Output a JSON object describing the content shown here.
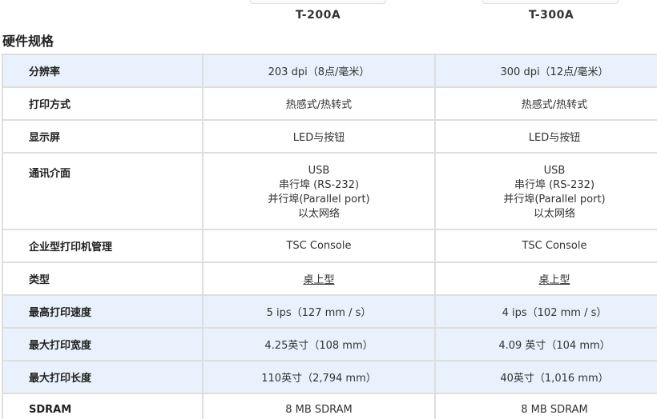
{
  "models": [
    "T-200A",
    "T-300A"
  ],
  "section_title": "硬件规格",
  "rows": [
    {
      "label": "分辨率",
      "v1": [
        "203 dpi（8点/毫米）"
      ],
      "v2": [
        "300 dpi（12点/毫米）"
      ],
      "style": "blue"
    },
    {
      "label": "打印方式",
      "v1": [
        "热感式/热转式"
      ],
      "v2": [
        "热感式/热转式"
      ],
      "style": "white"
    },
    {
      "label": "显示屏",
      "v1": [
        "LED与按钮"
      ],
      "v2": [
        "LED与按钮"
      ],
      "style": "white"
    },
    {
      "label": "通讯介面",
      "v1": [
        "USB",
        "串行埠 (RS-232)",
        "并行埠(Parallel port)",
        "以太网络"
      ],
      "v2": [
        "USB",
        "串行埠 (RS-232)",
        "并行埠(Parallel port)",
        "以太网络"
      ],
      "style": "white"
    },
    {
      "label": "企业型打印机管理",
      "v1": [
        "TSC Console"
      ],
      "v2": [
        "TSC Console"
      ],
      "style": "white"
    },
    {
      "label": "类型",
      "v1": [
        "桌上型"
      ],
      "v2": [
        "桌上型"
      ],
      "style": "white"
    },
    {
      "label": "最高打印速度",
      "v1": [
        "5 ips（127 mm / s）"
      ],
      "v2": [
        "4 ips（102 mm / s）"
      ],
      "style": "blue"
    },
    {
      "label": "最大打印宽度",
      "v1": [
        "4.25英寸（108 mm）"
      ],
      "v2": [
        "4.09 英寸（104 mm）"
      ],
      "style": "blue"
    },
    {
      "label": "最大打印长度",
      "v1": [
        "110英寸（2,794 mm）"
      ],
      "v2": [
        "40英寸（1,016 mm）"
      ],
      "style": "blue"
    },
    {
      "label": "SDRAM",
      "v1": [
        "8 MB SDRAM"
      ],
      "v2": [
        "8 MB SDRAM"
      ],
      "style": "white"
    }
  ]
}
